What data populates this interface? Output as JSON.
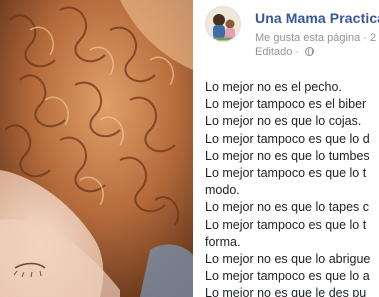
{
  "post": {
    "page_name": "Una Mama Practica",
    "like_label": "Me gusta esta página",
    "meta_separator": "·",
    "date_fragment": "2",
    "edited_label": "Editado",
    "lines": [
      "Lo mejor no es el pecho.",
      "Lo mejor tampoco es el biber",
      "Lo mejor no es que lo cojas.",
      "Lo mejor tampoco es que lo d",
      "Lo mejor no es que lo tumbes",
      "Lo mejor tampoco es que lo t",
      "modo.",
      "Lo mejor no es que lo tapes c",
      "Lo mejor tampoco es que lo t",
      "forma.",
      "Lo mejor no es que lo abrigue",
      "Lo mejor tampoco es que lo a",
      "Lo mejor no es que le des pu"
    ]
  },
  "colors": {
    "link": "#365899",
    "meta": "#90949c",
    "text": "#1d2129"
  }
}
